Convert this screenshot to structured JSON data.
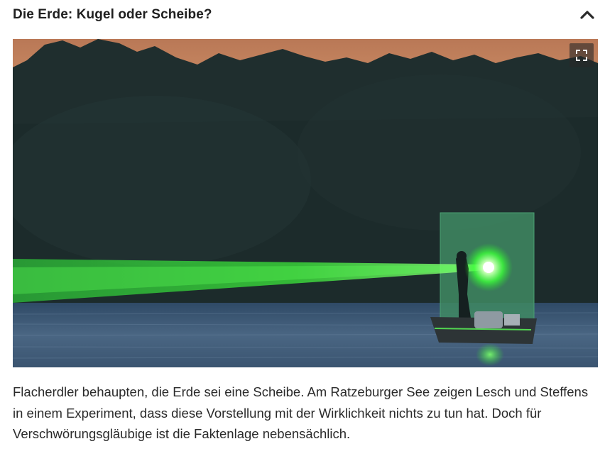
{
  "section": {
    "title": "Die Erde: Kugel oder Scheibe?",
    "collapse_icon": "chevron-up-icon",
    "expanded": true
  },
  "media": {
    "fullscreen_icon": "fullscreen-icon",
    "colors": {
      "sky_glow": "#c98a63",
      "laser": "#3dff3a",
      "water": "#3d5772",
      "treeline": "#1c2b2b"
    }
  },
  "caption": {
    "text": "Flacherdler behaupten, die Erde sei eine Scheibe. Am Ratzeburger See zeigen Lesch und Steffens in einem Experiment, dass diese Vorstellung mit der Wirklichkeit nichts zu tun hat. Doch für Verschwörungsgläubige ist die Faktenlage nebensächlich."
  }
}
